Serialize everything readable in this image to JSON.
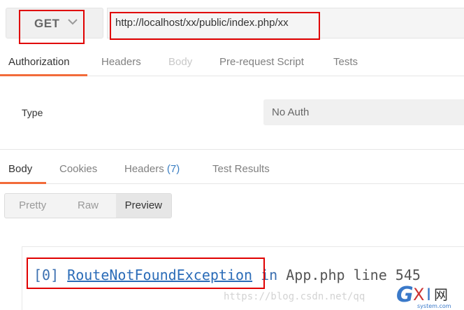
{
  "request": {
    "method": "GET",
    "url": "http://localhost/xx/public/index.php/xx"
  },
  "request_tabs": [
    {
      "label": "Authorization",
      "state": "active"
    },
    {
      "label": "Headers",
      "state": "normal"
    },
    {
      "label": "Body",
      "state": "disabled"
    },
    {
      "label": "Pre-request Script",
      "state": "normal"
    },
    {
      "label": "Tests",
      "state": "normal"
    }
  ],
  "auth": {
    "type_label": "Type",
    "type_value": "No Auth"
  },
  "response_tabs": {
    "body": "Body",
    "cookies": "Cookies",
    "headers": "Headers",
    "headers_count": "(7)",
    "test_results": "Test Results"
  },
  "view_modes": [
    "Pretty",
    "Raw",
    "Preview"
  ],
  "active_view_mode": "Preview",
  "preview": {
    "index": "[0]",
    "exception": "RouteNotFoundException",
    "in": "in",
    "location": "App.php line 545"
  },
  "watermark": "https://blog.csdn.net/qq",
  "logo": {
    "text": "GXI网",
    "sub": "system.com"
  },
  "colors": {
    "accent": "#f26b3a",
    "highlight": "#e00000",
    "link": "#2b6cb8"
  }
}
